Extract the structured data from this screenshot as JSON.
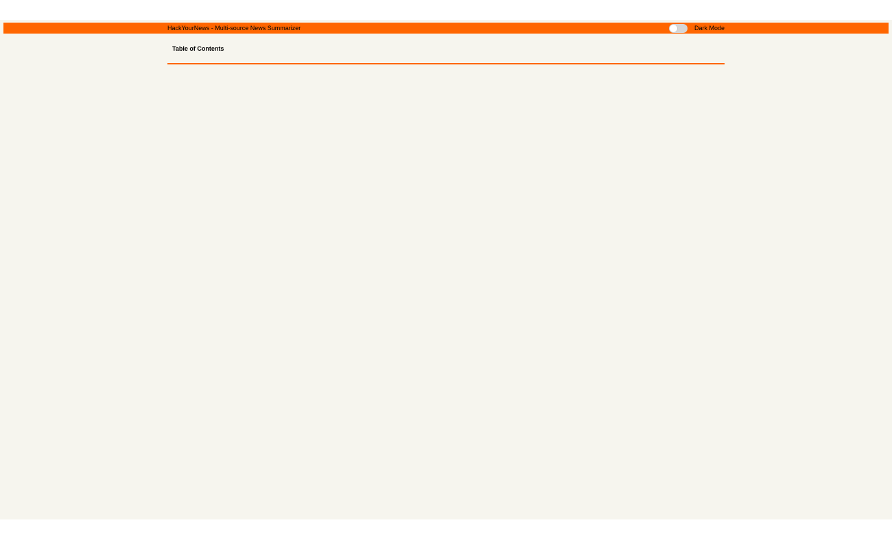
{
  "header": {
    "title": "HackYourNews - Multi-source News Summarizer",
    "dark_mode_label": "Dark Mode",
    "dark_mode_enabled": false,
    "accent_color": "#ff6600"
  },
  "toc": {
    "title": "Table of Contents"
  },
  "colors": {
    "page_background": "#f6f5ee",
    "toggle_off": "#d6d6d6"
  }
}
